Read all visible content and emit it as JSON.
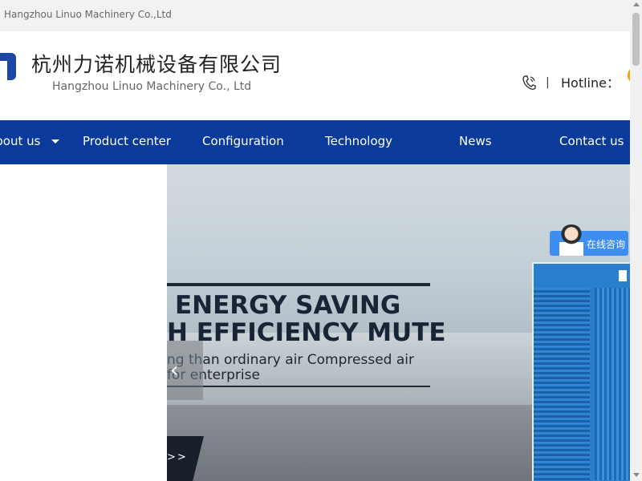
{
  "topbar": {
    "company": "Hangzhou Linuo Machinery Co.,Ltd"
  },
  "header": {
    "title": "杭州力诺机械设备有限公司",
    "subtitle": "Hangzhou Linuo Machinery Co., Ltd",
    "separator": "|",
    "hotline_label": "Hotline："
  },
  "nav": {
    "items": [
      {
        "label": "About us"
      },
      {
        "label": "Product center"
      },
      {
        "label": "Configuration"
      },
      {
        "label": "Technology"
      },
      {
        "label": "News"
      },
      {
        "label": "Contact us"
      }
    ]
  },
  "banner": {
    "heading_line1": "ENERGY SAVING",
    "heading_line2": "H EFFICIENCY MUTE",
    "sub_line1": "ng than ordinary air Compressed air",
    "sub_line2": "for enterprise",
    "prev_icon": "‹",
    "more_label": ">>"
  },
  "chat": {
    "label": "在线咨询"
  },
  "colors": {
    "nav_bg": "#0a3a9a",
    "accent": "#1d47a6",
    "chat": "#3d8ef0"
  }
}
